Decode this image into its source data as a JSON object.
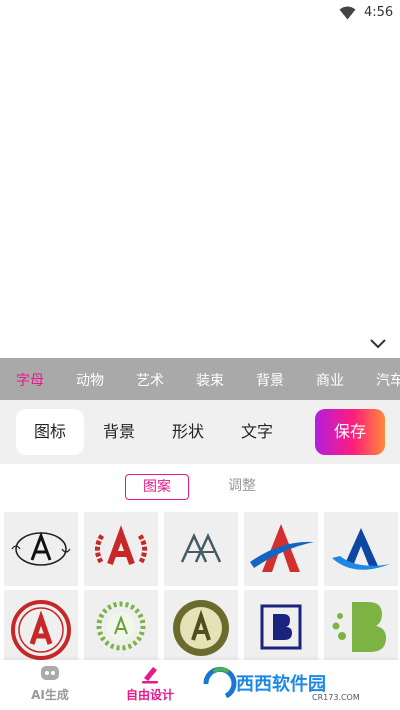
{
  "status_bar": {
    "time": "4:56",
    "wifi_icon": "wifi-icon"
  },
  "categories": [
    "字母",
    "动物",
    "艺术",
    "装束",
    "背景",
    "商业",
    "汽车"
  ],
  "active_category": "字母",
  "toolbar": {
    "tabs": [
      "图标",
      "背景",
      "形状",
      "文字"
    ],
    "active_tab": "图标",
    "save_label": "保存"
  },
  "subtabs": {
    "active": "图案",
    "inactive": "调整"
  },
  "icon_grid": {
    "row1": [
      "letter-a-ornate-frame",
      "letter-a-laurel-red",
      "letter-a-double-gray",
      "letter-a-red-swoosh",
      "letter-a-blue-swoosh"
    ],
    "row2": [
      "letter-a-red-circle",
      "letter-a-green-wreath",
      "letter-a-olive-seal",
      "letter-b-navy-square",
      "letter-b-green-dots"
    ]
  },
  "bottom_nav": {
    "items": [
      {
        "label": "AI生成",
        "icon": "robot-icon"
      },
      {
        "label": "自由设计",
        "icon": "pen-icon"
      }
    ]
  },
  "watermark": {
    "brand": "西西软件园",
    "domain": "CR173.COM"
  },
  "colors": {
    "accent": "#e8198b",
    "category_bar": "#a9a9a9",
    "toolbar_bg": "#f0f0f0"
  }
}
